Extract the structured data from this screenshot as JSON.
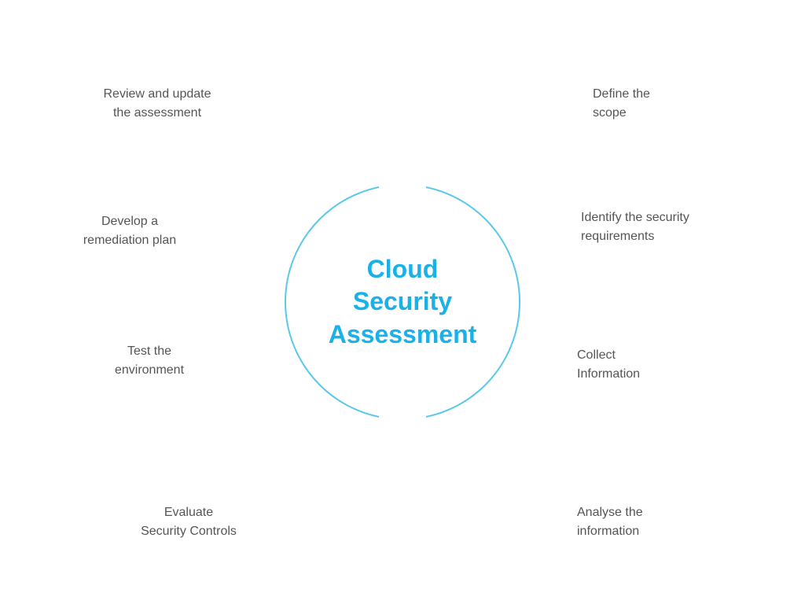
{
  "diagram": {
    "title": {
      "line1": "Cloud",
      "line2": "Security",
      "line3": "Assessment"
    },
    "labels": {
      "top_left": {
        "line1": "Review and update",
        "line2": "the assessment"
      },
      "top_right": {
        "line1": "Define the",
        "line2": "scope"
      },
      "middle_left": {
        "line1": "Develop a",
        "line2": "remediation plan"
      },
      "middle_right": {
        "line1": "Identify the security",
        "line2": "requirements"
      },
      "center_left": {
        "line1": "Test the",
        "line2": "environment"
      },
      "center_right": {
        "line1": "Collect",
        "line2": "Information"
      },
      "bottom_left": {
        "line1": "Evaluate",
        "line2": "Security Controls"
      },
      "bottom_right": {
        "line1": "Analyse the",
        "line2": "information"
      }
    }
  }
}
